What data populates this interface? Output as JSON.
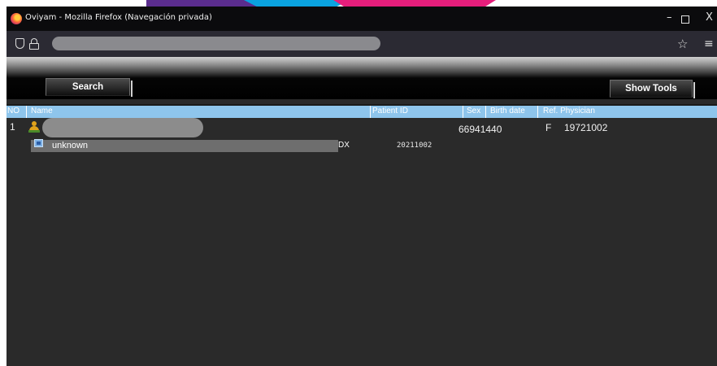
{
  "window": {
    "title": "Oviyam - Mozilla Firefox (Navegación privada)",
    "minimize_glyph": "–",
    "close_glyph": "X"
  },
  "nav": {
    "shield_icon": "shield-icon",
    "lock_icon": "lock-icon",
    "star_glyph": "☆",
    "menu_glyph": "≡"
  },
  "toolbar": {
    "search_label": "Search",
    "show_tools_label": "Show Tools"
  },
  "columns": {
    "no": "NO",
    "name": "Name",
    "patient_id": "Patient ID",
    "sex": "Sex",
    "birth_date": "Birth date",
    "ref_physician": "Ref. Physician"
  },
  "patient": {
    "no": "1",
    "patient_id": "66941440",
    "sex": "F",
    "birth_date": "19721002"
  },
  "study": {
    "description": "unknown",
    "modality": "DX",
    "date": "20211002"
  },
  "colors": {
    "header_bar": "#8ec5ec",
    "content_bg": "#2a2a2a",
    "patient_icon": "#e0a21b",
    "study_icon": "#7fb2e6"
  }
}
